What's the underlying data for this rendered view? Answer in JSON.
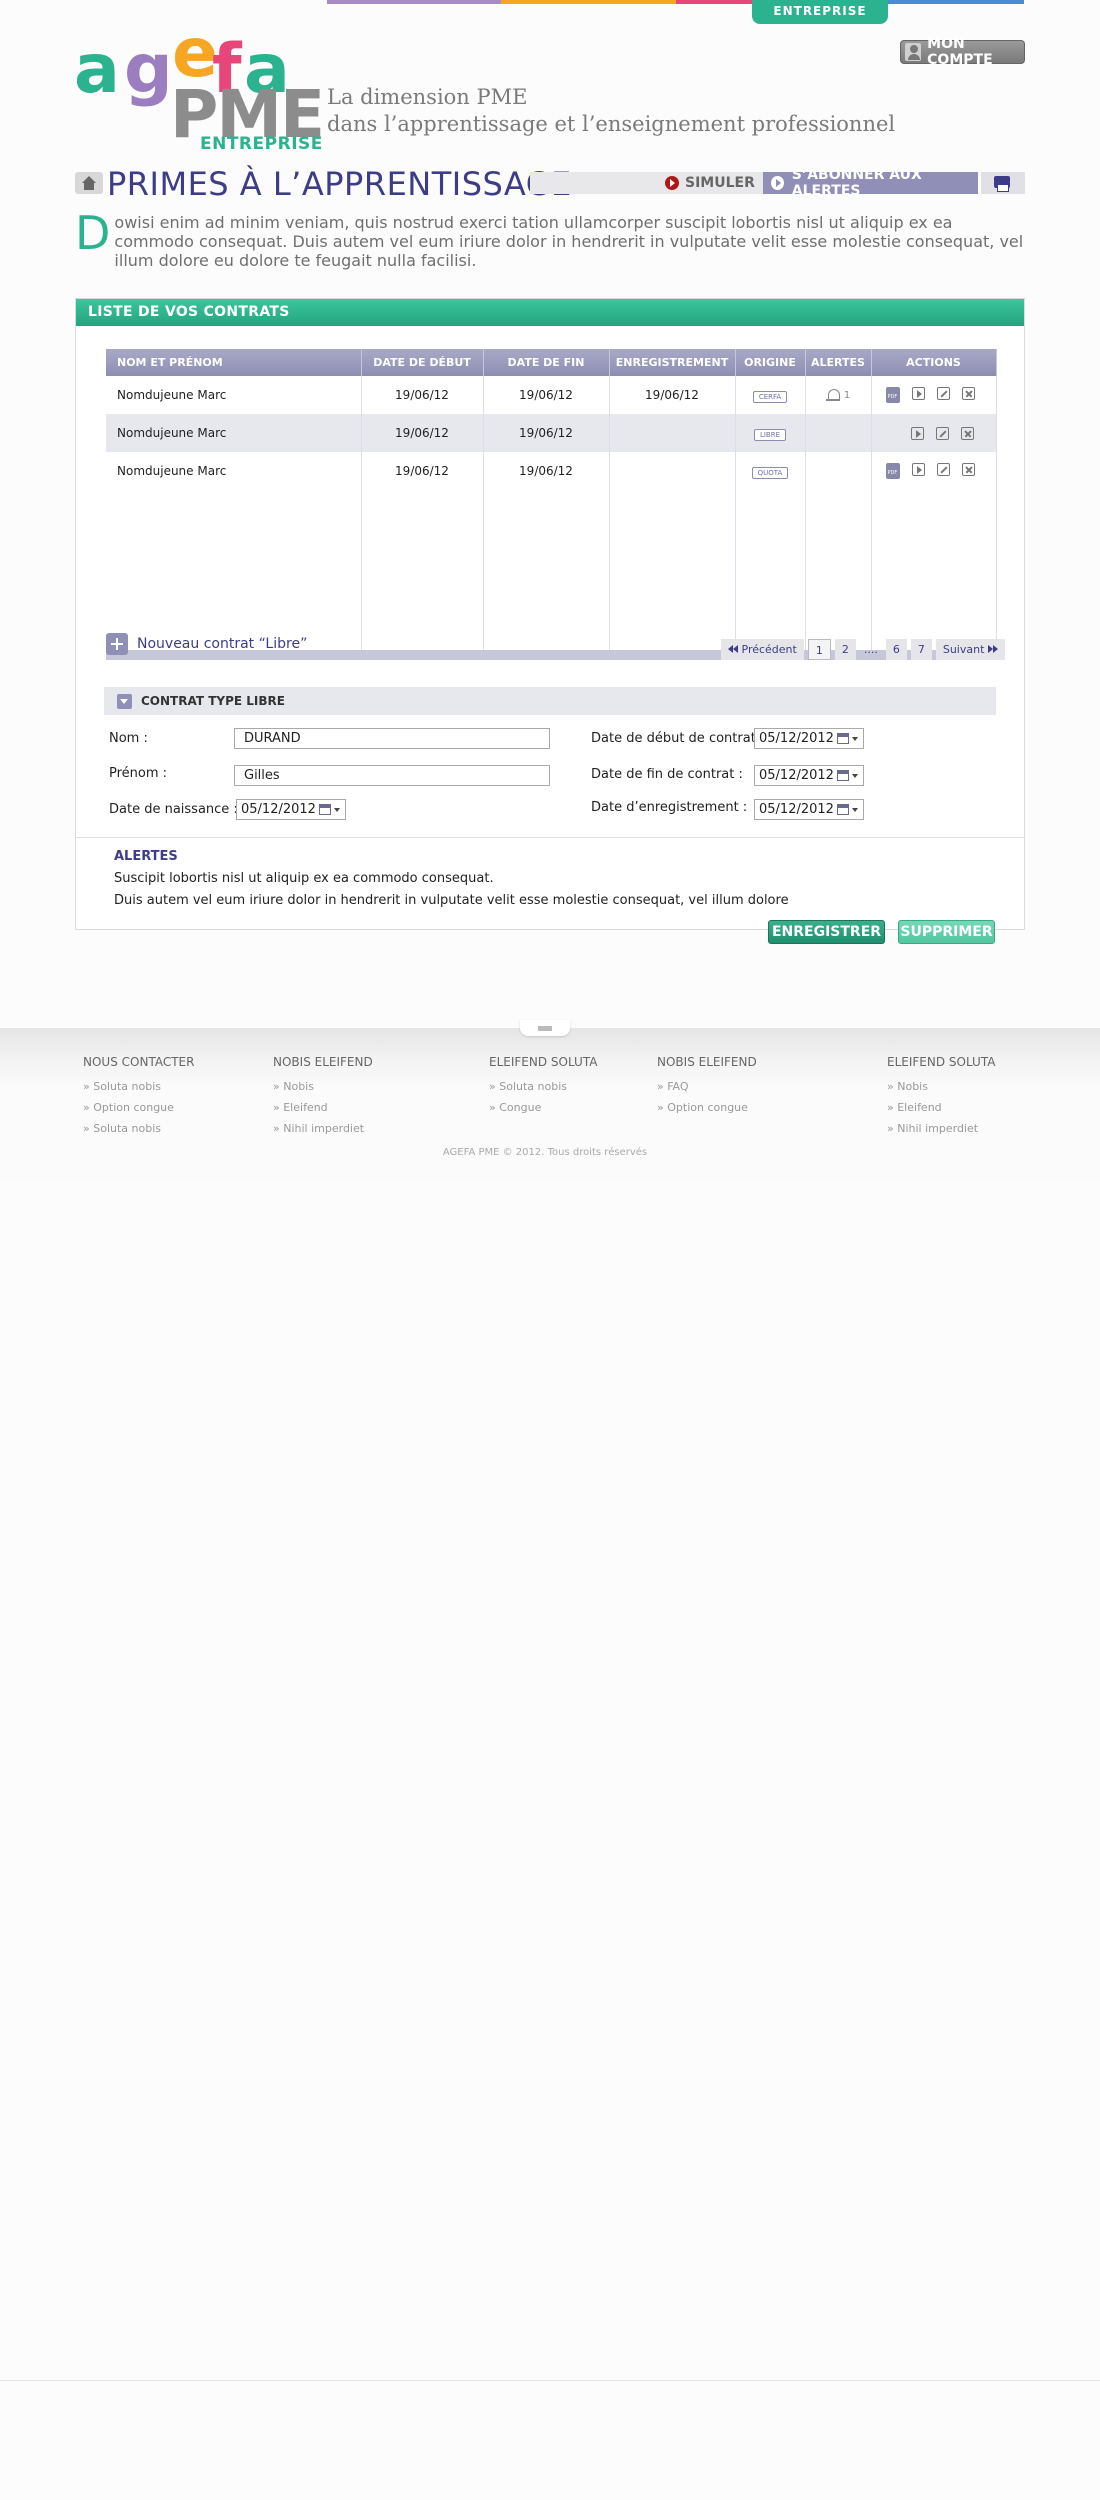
{
  "header": {
    "color_strip": [
      "#a68bc7",
      "#f6a623",
      "#e8457a",
      "#4a8bd6"
    ],
    "tab_label": "ENTREPRISE",
    "account_button": "MON COMPTE",
    "logo": {
      "letters": [
        "a",
        "g",
        "e",
        "f",
        "a"
      ],
      "main": "PME",
      "sub": "ENTREPRISE",
      "colors": [
        "#2ab38e",
        "#9b7ec0",
        "#f6a623",
        "#e8457a",
        "#2ab38e"
      ]
    },
    "tagline_line1": "La dimension PME",
    "tagline_line2": "dans l’apprentissage et l’enseignement professionnel"
  },
  "titlebar": {
    "title": "PRIMES À L’APPRENTISSAGE",
    "simuler": "SIMULER",
    "subscribe": "S’ABONNER AUX ALERTES"
  },
  "intro": {
    "dropcap": "D",
    "text": "owisi enim ad minim veniam, quis nostrud exerci tation ullamcorper suscipit lobortis nisl ut aliquip ex ea commodo consequat. Duis autem vel eum iriure dolor in hendrerit in vulputate velit esse molestie consequat, vel illum dolore eu dolore te feugait nulla facilisi."
  },
  "contracts": {
    "panel_title": "LISTE DE VOS CONTRATS",
    "columns": [
      "NOM ET PRÉNOM",
      "DATE DE DÉBUT",
      "DATE DE FIN",
      "ENREGISTREMENT",
      "ORIGINE",
      "ALERTES",
      "ACTIONS"
    ],
    "rows": [
      {
        "name": "Nomdujeune Marc",
        "start": "19/06/12",
        "end": "19/06/12",
        "registration": "19/06/12",
        "origin": "CERFA",
        "alerts": "1",
        "has_pdf": true
      },
      {
        "name": "Nomdujeune Marc",
        "start": "19/06/12",
        "end": "19/06/12",
        "registration": "",
        "origin": "LIBRE",
        "alerts": "",
        "has_pdf": false
      },
      {
        "name": "Nomdujeune Marc",
        "start": "19/06/12",
        "end": "19/06/12",
        "registration": "",
        "origin": "QUOTA",
        "alerts": "",
        "has_pdf": true
      }
    ],
    "new_contract": "Nouveau contrat “Libre”",
    "pager": {
      "prev": "Précédent",
      "pages": [
        "1",
        "2",
        "....",
        "6",
        "7"
      ],
      "current": "1",
      "next": "Suivant"
    }
  },
  "form": {
    "section_title": "CONTRAT TYPE LIBRE",
    "nom_label": "Nom :",
    "nom_value": "DURAND",
    "prenom_label": "Prénom :",
    "prenom_value": "Gilles",
    "naissance_label": "Date de naissance :",
    "naissance_value": "05/12/2012",
    "debut_label": "Date de début de contrat :",
    "debut_value": "05/12/2012",
    "fin_label": "Date de fin de contrat :",
    "fin_value": "05/12/2012",
    "enreg_label": "Date d’enregistrement :",
    "enreg_value": "05/12/2012"
  },
  "alertes": {
    "title": "ALERTES",
    "line1": "Suscipit lobortis nisl ut aliquip ex ea commodo consequat.",
    "line2": "Duis autem vel eum iriure dolor in hendrerit in vulputate velit esse molestie consequat, vel illum dolore"
  },
  "buttons": {
    "save": "ENREGISTRER",
    "delete": "SUPPRIMER"
  },
  "footer": {
    "columns": [
      {
        "title": "NOUS CONTACTER",
        "items": [
          "Soluta nobis",
          "Option congue",
          "Soluta nobis"
        ]
      },
      {
        "title": "NOBIS ELEIFEND",
        "items": [
          "Nobis",
          "Eleifend",
          "Nihil imperdiet"
        ]
      },
      {
        "title": "ELEIFEND SOLUTA",
        "items": [
          "Soluta nobis",
          "Congue"
        ]
      },
      {
        "title": "NOBIS ELEIFEND",
        "items": [
          "FAQ",
          "Option congue"
        ]
      },
      {
        "title": "ELEIFEND SOLUTA",
        "items": [
          "Nobis",
          "Eleifend",
          "Nihil imperdiet"
        ]
      }
    ],
    "copyright": "AGEFA PME © 2012. Tous droits réservés"
  }
}
